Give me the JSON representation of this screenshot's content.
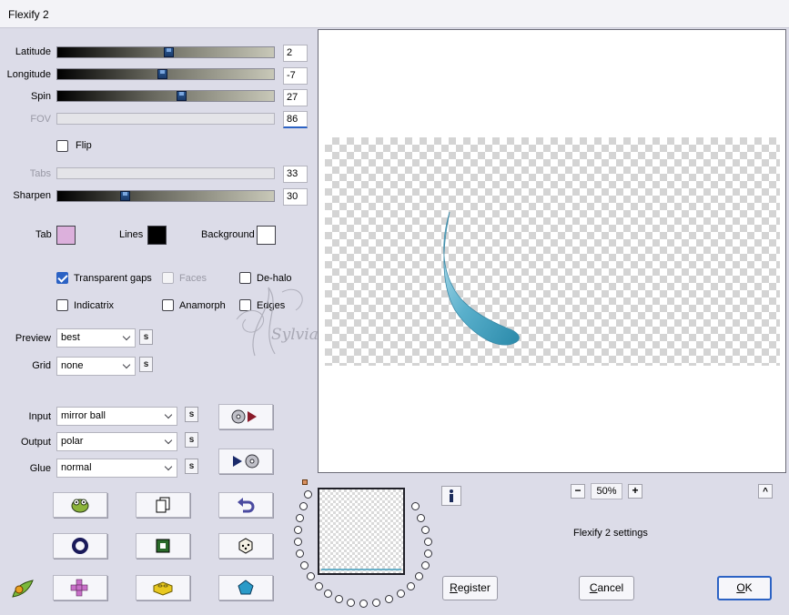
{
  "window": {
    "title": "Flexify 2"
  },
  "sliders": [
    {
      "key": "latitude",
      "label": "Latitude",
      "value": "2",
      "fraction": 0.52,
      "enabled": true
    },
    {
      "key": "longitude",
      "label": "Longitude",
      "value": "-7",
      "fraction": 0.48,
      "enabled": true
    },
    {
      "key": "spin",
      "label": "Spin",
      "value": "27",
      "fraction": 0.57,
      "enabled": true
    },
    {
      "key": "fov",
      "label": "FOV",
      "value": "86",
      "fraction": 0.0,
      "enabled": false
    },
    {
      "key": "tabs",
      "label": "Tabs",
      "value": "33",
      "fraction": 0.0,
      "enabled": false
    },
    {
      "key": "sharpen",
      "label": "Sharpen",
      "value": "30",
      "fraction": 0.31,
      "enabled": true
    }
  ],
  "flip": {
    "label": "Flip",
    "checked": false
  },
  "colors": {
    "tab": {
      "label": "Tab",
      "value": "#dcb0dc"
    },
    "lines": {
      "label": "Lines",
      "value": "#000000"
    },
    "background": {
      "label": "Background",
      "value": "#ffffff"
    }
  },
  "options": {
    "transparent_gaps": {
      "label": "Transparent gaps",
      "checked": true
    },
    "faces": {
      "label": "Faces",
      "checked": false,
      "enabled": false
    },
    "de_halo": {
      "label": "De-halo",
      "checked": false
    },
    "indicatrix": {
      "label": "Indicatrix",
      "checked": false
    },
    "anamorph": {
      "label": "Anamorph",
      "checked": false
    },
    "edges": {
      "label": "Edges",
      "checked": false
    }
  },
  "preview": {
    "label": "Preview",
    "value": "best"
  },
  "grid": {
    "label": "Grid",
    "value": "none"
  },
  "input": {
    "label": "Input",
    "value": "mirror ball"
  },
  "output": {
    "label": "Output",
    "value": "polar"
  },
  "glue": {
    "label": "Glue",
    "value": "normal"
  },
  "small_button_label": "s",
  "watermark_text": "Sylviane",
  "zoom": {
    "value": "50%",
    "minus": "−",
    "plus": "+"
  },
  "scroll_up_label": "^",
  "settings_text": "Flexify 2 settings",
  "buttons": {
    "register": {
      "prefix": "R",
      "rest": "egister"
    },
    "cancel": {
      "prefix": "C",
      "rest": "ancel"
    },
    "ok": {
      "prefix": "O",
      "rest": "K"
    }
  },
  "accent_color": "#2b62c4"
}
